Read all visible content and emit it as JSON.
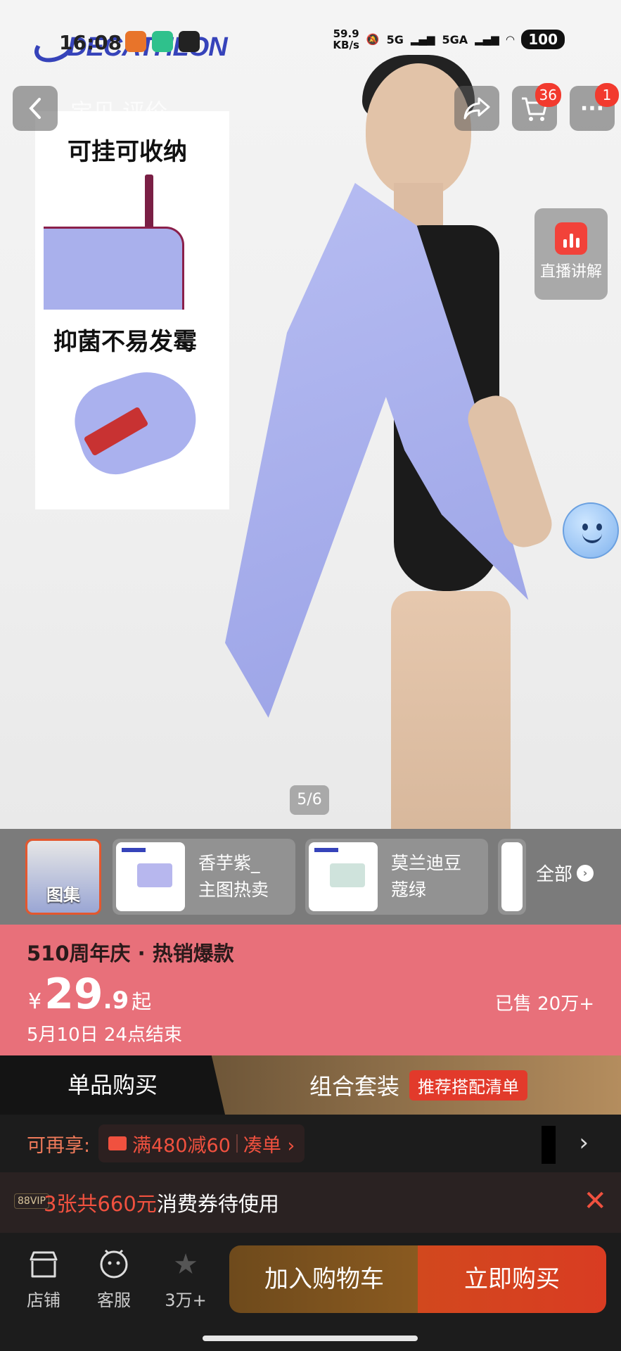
{
  "status_bar": {
    "time": "16:08",
    "net_speed": "59.9\nKB/s",
    "signal1": "5G",
    "signal2": "5GA",
    "battery": "100"
  },
  "brand": {
    "logo_text": "DECATHLON"
  },
  "header": {
    "breadcrumb": "宝贝 评价",
    "cart_badge": "36",
    "more_badge": "1"
  },
  "feature_card": {
    "title1": "可挂可收纳",
    "title2": "抑菌不易发霉"
  },
  "live": {
    "label": "直播讲解"
  },
  "gallery": {
    "pager": "5/6"
  },
  "variants": {
    "first_tag": "图集",
    "items": [
      {
        "label_line1": "香芋紫_",
        "label_line2": "主图热卖"
      },
      {
        "label_line1": "莫兰迪豆",
        "label_line2": "蔻绿"
      }
    ],
    "all_label": "全部"
  },
  "promo": {
    "title": "510周年庆 · 热销爆款",
    "currency": "¥",
    "price_int": "29",
    "price_dec": ".9",
    "price_suffix": "起",
    "sold": "已售 20万+",
    "deadline": "5月10日 24点结束"
  },
  "tabs": {
    "single": "单品购买",
    "bundle": "组合套装",
    "bundle_chip": "推荐搭配清单"
  },
  "extra": {
    "label": "可再享:",
    "coupon": "满480减60",
    "action": "凑单 ›"
  },
  "vip": {
    "tag": "88VIP",
    "highlight": "3张共660元",
    "text": "消费券待使用"
  },
  "bottom": {
    "store": "店铺",
    "service": "客服",
    "fav": "3万+",
    "add_cart": "加入购物车",
    "buy_now": "立即购买"
  }
}
